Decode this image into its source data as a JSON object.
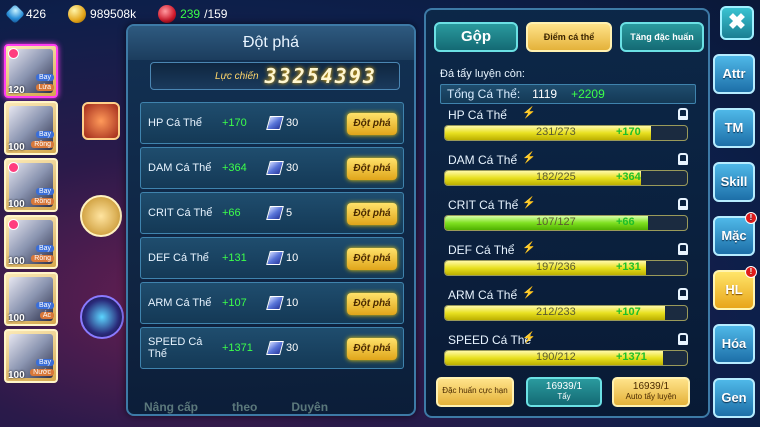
{
  "topbar": {
    "gems": "426",
    "gold": "989508k",
    "stamina_current": "239",
    "stamina_max": "/159"
  },
  "team": [
    {
      "level": "120",
      "tags": [
        "Bay",
        "Lửa"
      ]
    },
    {
      "level": "100",
      "tags": [
        "Bay",
        "Rồng"
      ]
    },
    {
      "level": "100",
      "tags": [
        "Bay",
        "Rồng"
      ]
    },
    {
      "level": "100",
      "tags": [
        "Bay",
        "Rồng"
      ]
    },
    {
      "level": "100",
      "tags": [
        "Bay",
        "Ác"
      ]
    },
    {
      "level": "100",
      "tags": [
        "Bay",
        "Nước"
      ]
    }
  ],
  "left_panel": {
    "title": "Đột phá",
    "power_label": "Lực chiến",
    "power_value": "33254393",
    "button_label": "Đột phá",
    "rows": [
      {
        "name": "HP Cá Thể",
        "bonus": "+170",
        "cost": "30"
      },
      {
        "name": "DAM Cá Thể",
        "bonus": "+364",
        "cost": "30"
      },
      {
        "name": "CRIT Cá Thể",
        "bonus": "+66",
        "cost": "5"
      },
      {
        "name": "DEF Cá Thể",
        "bonus": "+131",
        "cost": "10"
      },
      {
        "name": "ARM Cá Thể",
        "bonus": "+107",
        "cost": "10"
      },
      {
        "name": "SPEED Cá Thể",
        "bonus": "+1371",
        "cost": "30"
      }
    ]
  },
  "background_labels": [
    "Nâng cấp",
    "theo",
    "Duyên"
  ],
  "right_panel": {
    "tabs": {
      "merge": "Gộp",
      "points": "Điểm cá thể",
      "special": "Tăng đặc huấn"
    },
    "subtitle": "Đá tẩy luyện còn:",
    "total": {
      "label": "Tổng Cá Thể:",
      "value": "1119",
      "bonus": "+2209"
    },
    "stats": [
      {
        "name": "HP Cá Thể",
        "value": "231/273",
        "bonus": "+170",
        "fill": 0.85,
        "color": "yellow"
      },
      {
        "name": "DAM Cá Thể",
        "value": "182/225",
        "bonus": "+364",
        "fill": 0.81,
        "color": "yellow"
      },
      {
        "name": "CRIT Cá Thể",
        "value": "107/127",
        "bonus": "+66",
        "fill": 0.84,
        "color": "green"
      },
      {
        "name": "DEF Cá Thể",
        "value": "197/236",
        "bonus": "+131",
        "fill": 0.83,
        "color": "yellow"
      },
      {
        "name": "ARM Cá Thể",
        "value": "212/233",
        "bonus": "+107",
        "fill": 0.91,
        "color": "yellow"
      },
      {
        "name": "SPEED Cá Thể",
        "value": "190/212",
        "bonus": "+1371",
        "fill": 0.9,
        "color": "yellow"
      }
    ],
    "bottom": {
      "special_train": "Đặc huấn cực hạn",
      "wash_count": "16939/1",
      "wash_label": "Tẩy",
      "auto_count": "16939/1",
      "auto_label": "Auto tẩy luyện"
    }
  },
  "menu": {
    "close": "✖",
    "items": [
      {
        "label": "Attr",
        "badge": ""
      },
      {
        "label": "TM",
        "badge": ""
      },
      {
        "label": "Skill",
        "badge": ""
      },
      {
        "label": "Mặc",
        "badge": "!"
      },
      {
        "label": "HL",
        "badge": "!"
      },
      {
        "label": "Hóa",
        "badge": ""
      },
      {
        "label": "Gen",
        "badge": ""
      }
    ]
  },
  "colors": {
    "accent_gold": "#e4b23a",
    "accent_teal": "#2a9a9e",
    "bonus_green": "#3cff4a"
  },
  "icons": [
    "gem-icon",
    "gold-coin-icon",
    "stamina-potion-icon",
    "breakthrough-stone-icon",
    "lock-icon",
    "lightning-icon",
    "close-icon"
  ]
}
